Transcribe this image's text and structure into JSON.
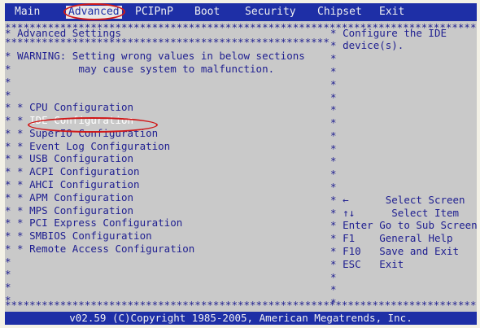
{
  "menu": {
    "items": [
      "Main",
      "Advanced",
      "PCIPnP",
      "Boot",
      "Security",
      "Chipset",
      "Exit"
    ],
    "active": "Advanced"
  },
  "left": {
    "title": "Advanced Settings",
    "warning_line1": "WARNING: Setting wrong values in below sections",
    "warning_line2": "may cause system to malfunction.",
    "items": [
      "CPU Configuration",
      "IDE Configuration",
      "SuperIO Configuration",
      "Event Log Configuration",
      "USB Configuration",
      "ACPI Configuration",
      "AHCI Configuration",
      "APM Configuration",
      "MPS Configuration",
      "PCI Express Configuration",
      "SMBIOS Configuration",
      "Remote Access Configuration"
    ],
    "selected_item": "IDE Configuration"
  },
  "right": {
    "help_line1": "Configure the IDE",
    "help_line2": "device(s).",
    "keys": [
      {
        "key": "←",
        "desc": "Select Screen"
      },
      {
        "key": "↑↓",
        "desc": "Select Item"
      },
      {
        "key": "Enter",
        "desc": "Go to Sub Screen"
      },
      {
        "key": "F1",
        "desc": "General Help"
      },
      {
        "key": "F10",
        "desc": "Save and Exit"
      },
      {
        "key": "ESC",
        "desc": "Exit"
      }
    ]
  },
  "footer": {
    "text": "v02.59 (C)Copyright 1985-2005, American Megatrends, Inc."
  },
  "colors": {
    "background": "#c9c9c9",
    "menubar": "#1e2fa6",
    "text": "#1e1e90",
    "selected": "#ffffff",
    "annotation": "#d01818"
  }
}
